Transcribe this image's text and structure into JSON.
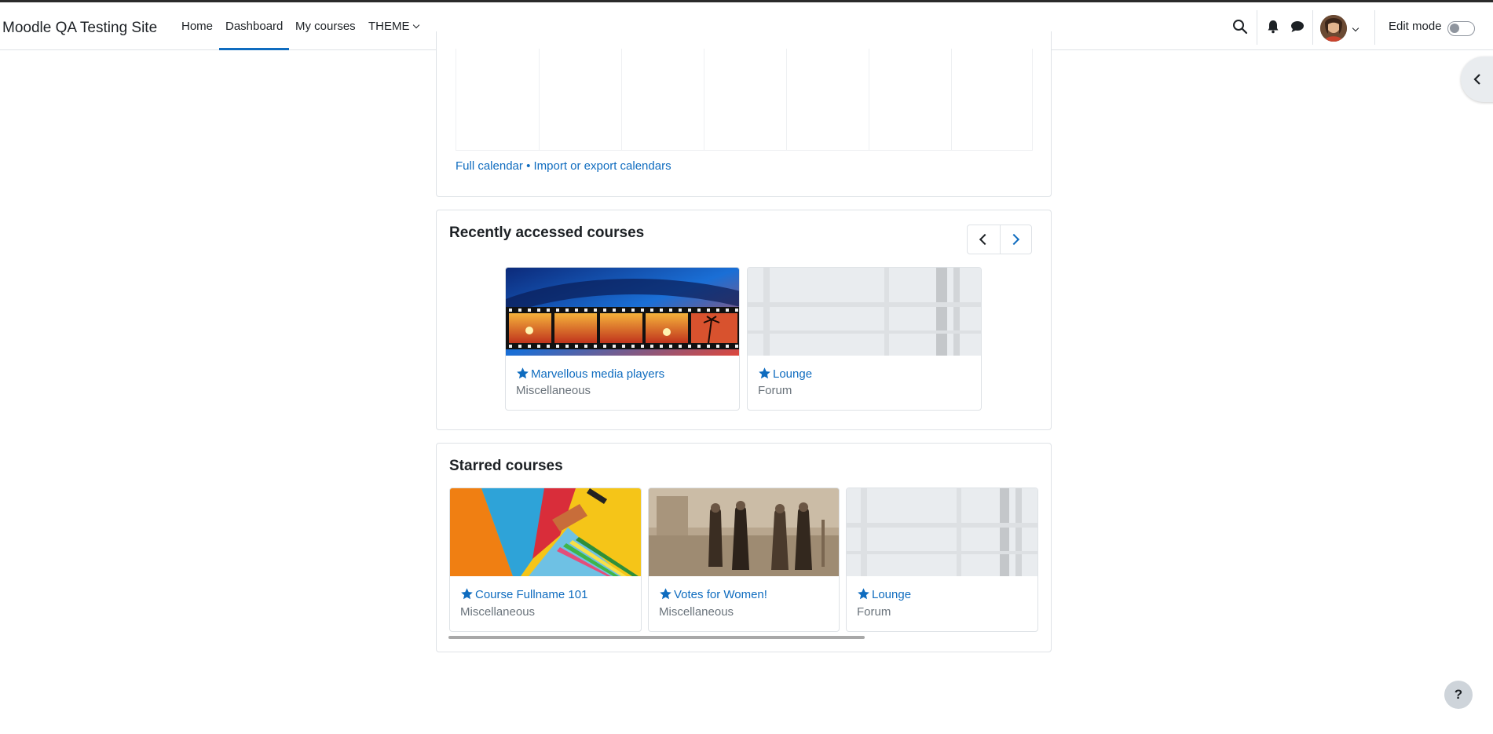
{
  "navbar": {
    "brand": "Moodle QA Testing Site",
    "items": [
      {
        "label": "Home"
      },
      {
        "label": "Dashboard"
      },
      {
        "label": "My courses"
      },
      {
        "label": "THEME"
      }
    ],
    "active_item": "Dashboard",
    "edit_mode_label": "Edit mode",
    "edit_mode_on": false,
    "icons": [
      "search-icon",
      "bell-icon",
      "message-icon",
      "avatar",
      "chevron-down-icon"
    ]
  },
  "calendar": {
    "full_calendar_link": "Full calendar",
    "separator": "•",
    "import_export_link": "Import or export calendars"
  },
  "recent": {
    "title": "Recently accessed courses",
    "courses": [
      {
        "name": "Marvellous media players",
        "category": "Miscellaneous",
        "starred": true
      },
      {
        "name": "Lounge",
        "category": "Forum",
        "starred": true
      }
    ]
  },
  "starred": {
    "title": "Starred courses",
    "courses": [
      {
        "name": "Course Fullname 101",
        "category": "Miscellaneous",
        "starred": true
      },
      {
        "name": "Votes for Women!",
        "category": "Miscellaneous",
        "starred": true
      },
      {
        "name": "Lounge",
        "category": "Forum",
        "starred": true
      }
    ]
  },
  "help": {
    "label": "?"
  },
  "colors": {
    "accent": "#0f6cbf",
    "muted": "#6a737b",
    "border": "#dee2e6"
  }
}
